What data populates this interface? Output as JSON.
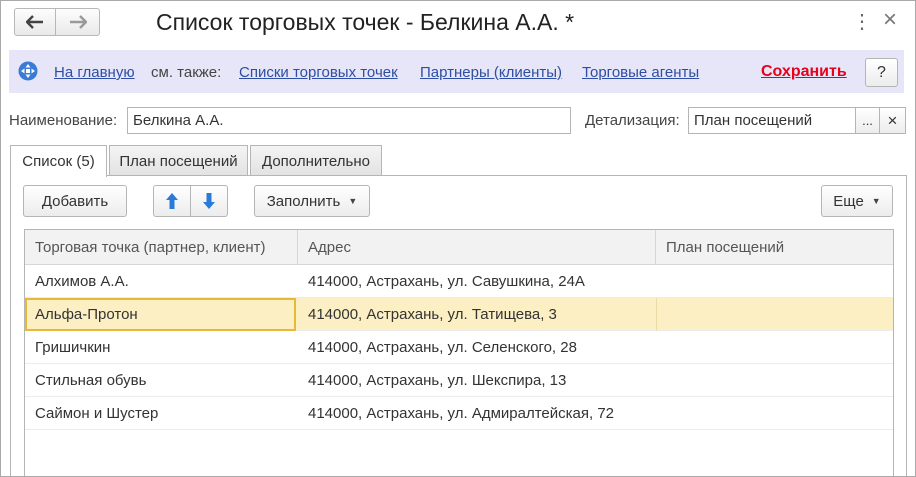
{
  "window": {
    "title": "Список торговых точек - Белкина А.А. *",
    "more_icon": "⋮",
    "close_icon": "×"
  },
  "commandbar": {
    "home_link": "На главную",
    "see_also": "см. также:",
    "links": [
      "Списки торговых точек",
      "Партнеры (клиенты)",
      "Торговые агенты"
    ],
    "save": "Сохранить",
    "help": "?"
  },
  "header": {
    "name_label": "Наименование:",
    "name_value": "Белкина А.А.",
    "detail_label": "Детализация:",
    "detail_value": "План посещений",
    "select_button": "...",
    "clear_button": "×"
  },
  "tabs": [
    {
      "label": "Список (5)",
      "active": true
    },
    {
      "label": "План посещений",
      "active": false
    },
    {
      "label": "Дополнительно",
      "active": false
    }
  ],
  "toolbar": {
    "add": "Добавить",
    "fill": "Заполнить",
    "more": "Еще"
  },
  "table": {
    "columns": [
      "Торговая точка (партнер, клиент)",
      "Адрес",
      "План посещений"
    ],
    "rows": [
      [
        "Алхимов А.А.",
        "414000, Астрахань, ул. Савушкина, 24А",
        ""
      ],
      [
        "Альфа-Протон",
        "414000, Астрахань, ул. Татищева, 3",
        ""
      ],
      [
        "Гришичкин",
        "414000, Астрахань, ул. Селенского, 28",
        ""
      ],
      [
        "Стильная обувь",
        "414000, Астрахань, ул. Шекспира, 13",
        ""
      ],
      [
        "Саймон и Шустер",
        "414000, Астрахань, ул. Адмиралтейская, 72",
        ""
      ]
    ],
    "selected_row": 1
  },
  "colors": {
    "link": "#2d4ea3",
    "save": "#e8001c",
    "panel": "#e6e6f8",
    "selected_row": "#fbefc3",
    "focus_border": "#e8b83a",
    "arrow_blue": "#2a7bd8"
  }
}
